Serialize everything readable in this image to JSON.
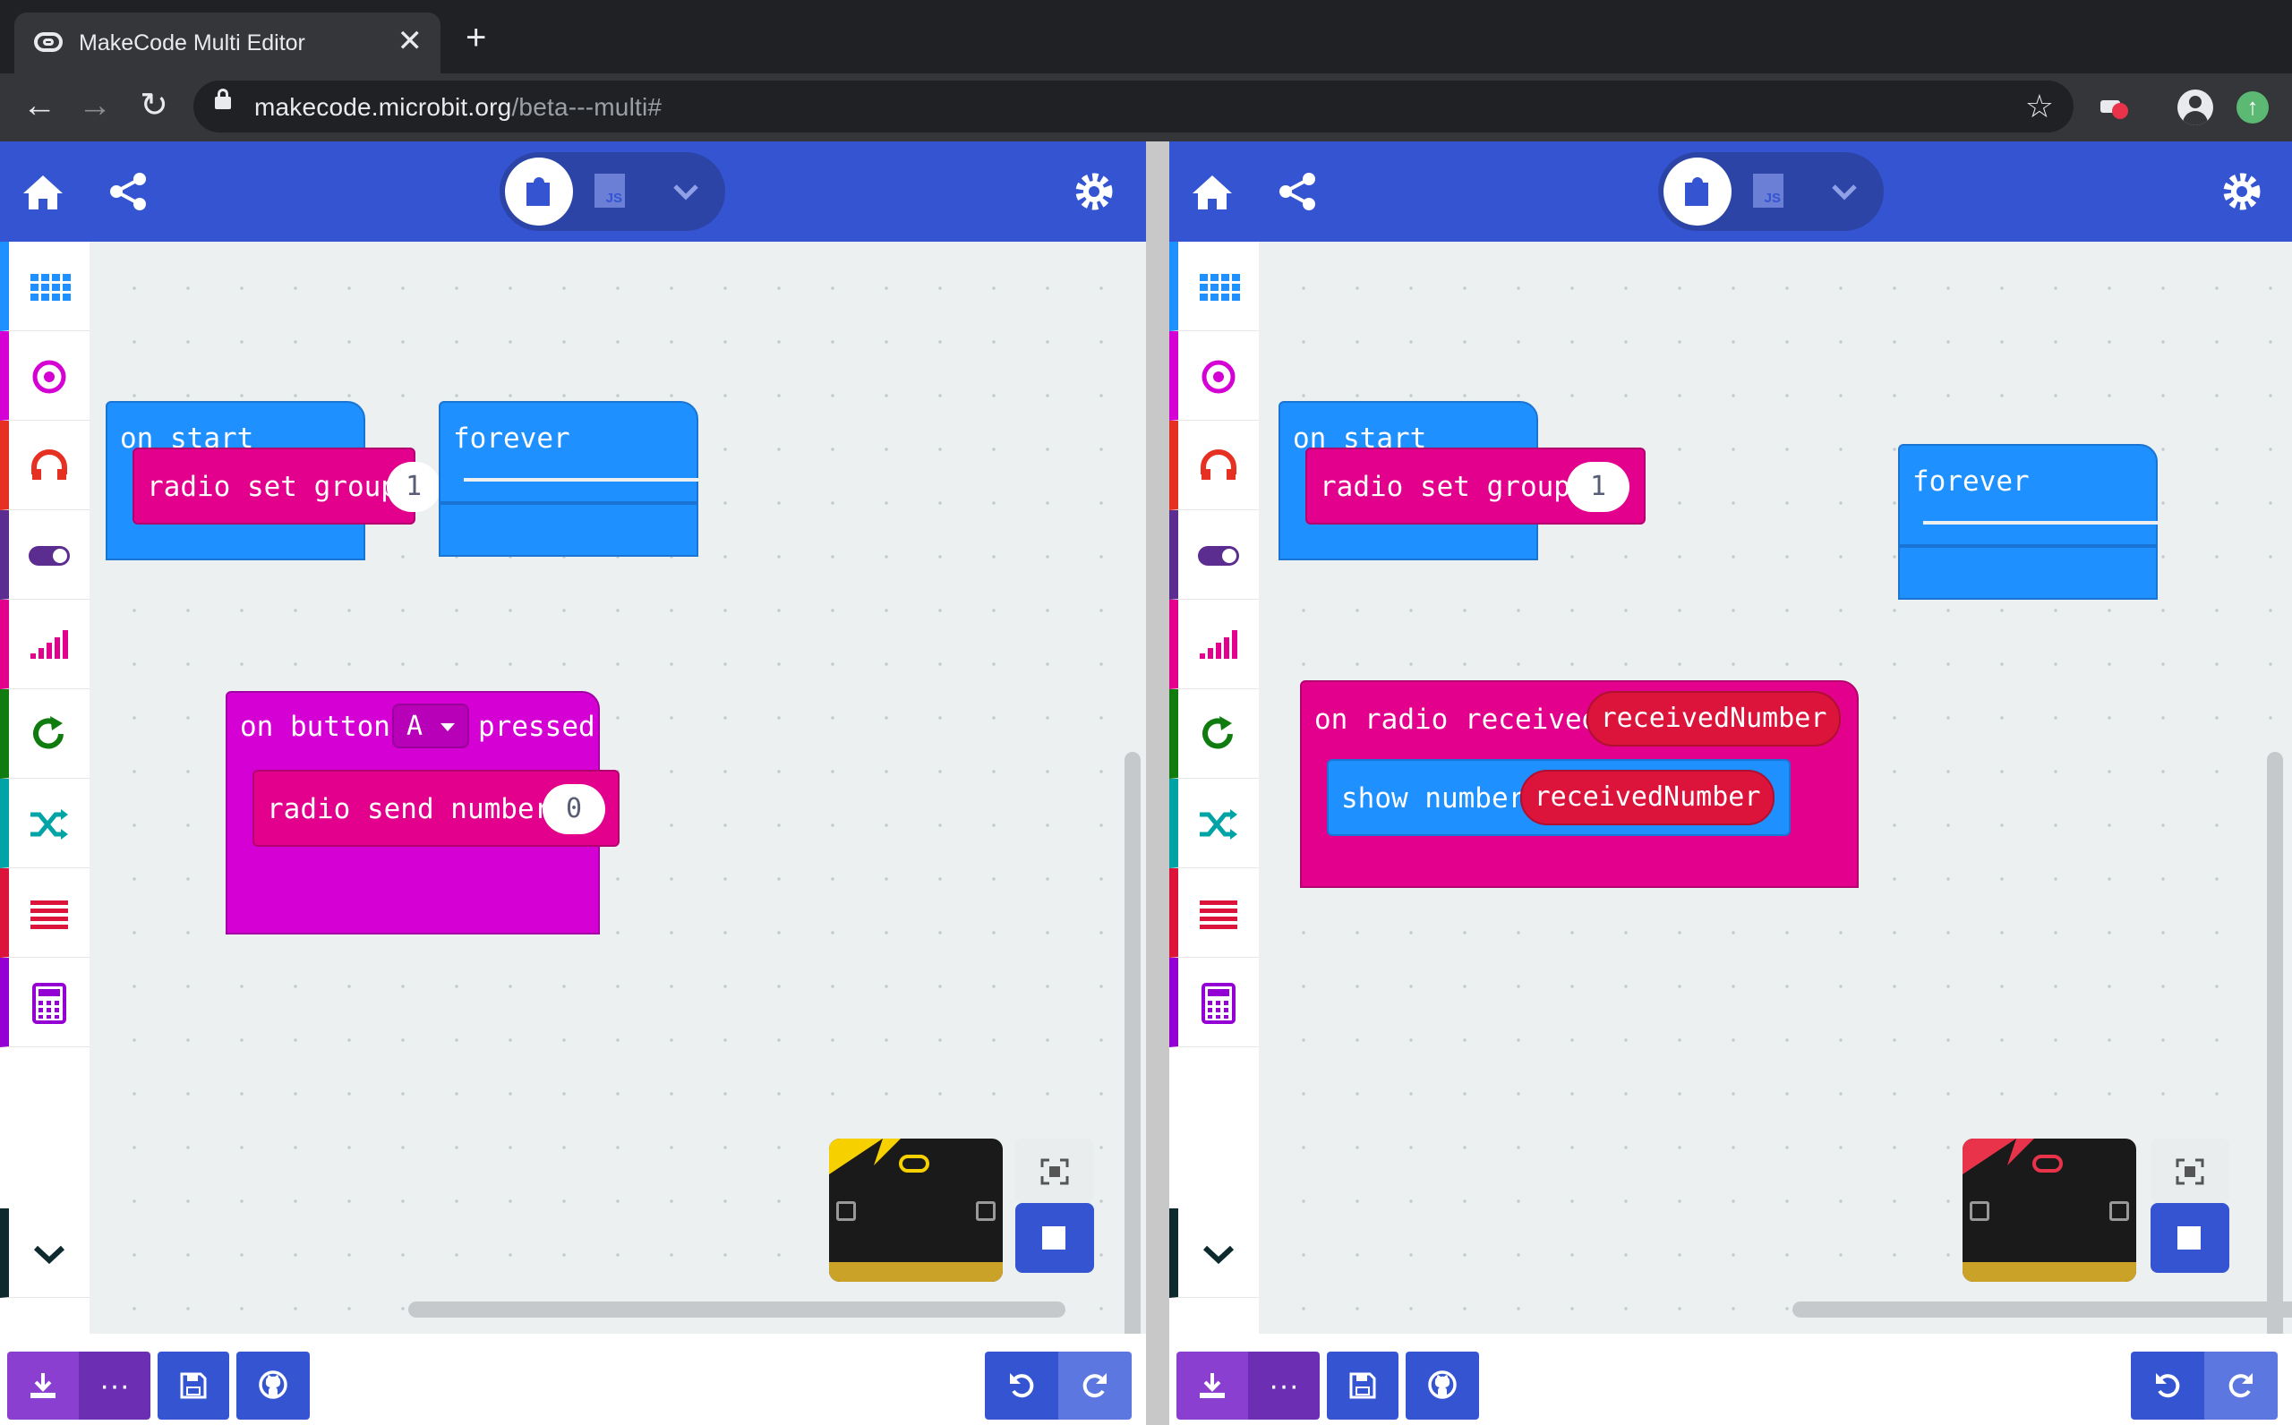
{
  "browser": {
    "tab_title": "MakeCode Multi Editor",
    "tab_close": "✕",
    "new_tab": "+",
    "url_host": "makecode.microbit.org",
    "url_path": "/beta---multi#",
    "back": "←",
    "forward": "→",
    "reload": "↻",
    "bookmark": "☆"
  },
  "editor_toggle": {
    "js_label": "JS"
  },
  "left_pane": {
    "blocks": {
      "on_start": "on start",
      "radio_set_group": "radio set group",
      "group_value": "1",
      "forever": "forever",
      "on_button_prefix": "on button",
      "button_value": "A",
      "on_button_suffix": "pressed",
      "radio_send_number": "radio send number",
      "send_value": "0"
    },
    "sim_accent": "#f7d000"
  },
  "right_pane": {
    "blocks": {
      "on_start": "on start",
      "radio_set_group": "radio set group",
      "group_value": "1",
      "forever": "forever",
      "on_radio_received": "on radio received",
      "received_var": "receivedNumber",
      "show_number": "show number",
      "show_var": "receivedNumber"
    },
    "sim_accent": "#e8334a"
  },
  "toolbox_categories": [
    {
      "name": "Basic",
      "icon": "grid-icon",
      "color": "#1e90ff"
    },
    {
      "name": "Input",
      "icon": "target-icon",
      "color": "#d400d4"
    },
    {
      "name": "Music",
      "icon": "headphones-icon",
      "color": "#e63022"
    },
    {
      "name": "Led",
      "icon": "toggle-icon",
      "color": "#5c2d91"
    },
    {
      "name": "Radio",
      "icon": "signal-icon",
      "color": "#e3008c"
    },
    {
      "name": "Loops",
      "icon": "loop-icon",
      "color": "#00a4a6"
    },
    {
      "name": "Logic",
      "icon": "shuffle-icon",
      "color": "#00a4a6"
    },
    {
      "name": "Variables",
      "icon": "lines-icon",
      "color": "#dc143c"
    },
    {
      "name": "Math",
      "icon": "calculator-icon",
      "color": "#9400d3"
    }
  ],
  "bottom": {
    "more_label": "···"
  }
}
